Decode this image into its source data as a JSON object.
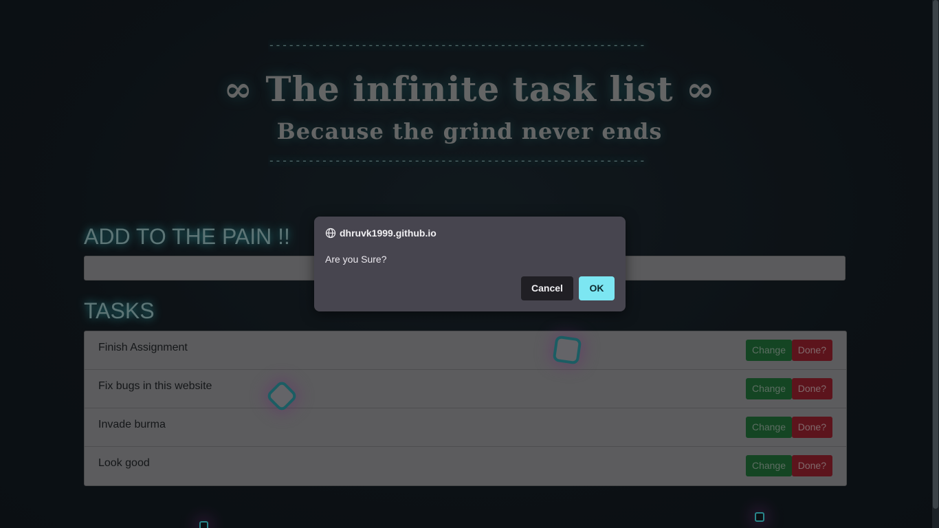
{
  "header": {
    "dashes": "---------------------------------------------------------",
    "title": "∞ The infinite task list ∞",
    "subtitle": "Because the grind never ends"
  },
  "add_section": {
    "heading": "ADD TO THE PAIN !!",
    "input_value": ""
  },
  "tasks_section": {
    "heading": "TASKS",
    "items": [
      {
        "label": "Finish Assignment",
        "change": "Change",
        "done": "Done?"
      },
      {
        "label": "Fix bugs in this website",
        "change": "Change",
        "done": "Done?"
      },
      {
        "label": "Invade burma",
        "change": "Change",
        "done": "Done?"
      },
      {
        "label": "Look good",
        "change": "Change",
        "done": "Done?"
      }
    ]
  },
  "dialog": {
    "origin": "dhruvk1999.github.io",
    "message": "Are you Sure?",
    "cancel_label": "Cancel",
    "ok_label": "OK",
    "icon": "globe-icon"
  },
  "colors": {
    "accent_glow": "#3fd0d8",
    "change_button": "#1f6b36",
    "done_button": "#8e1f2b",
    "dialog_ok": "#7ce6f2"
  }
}
